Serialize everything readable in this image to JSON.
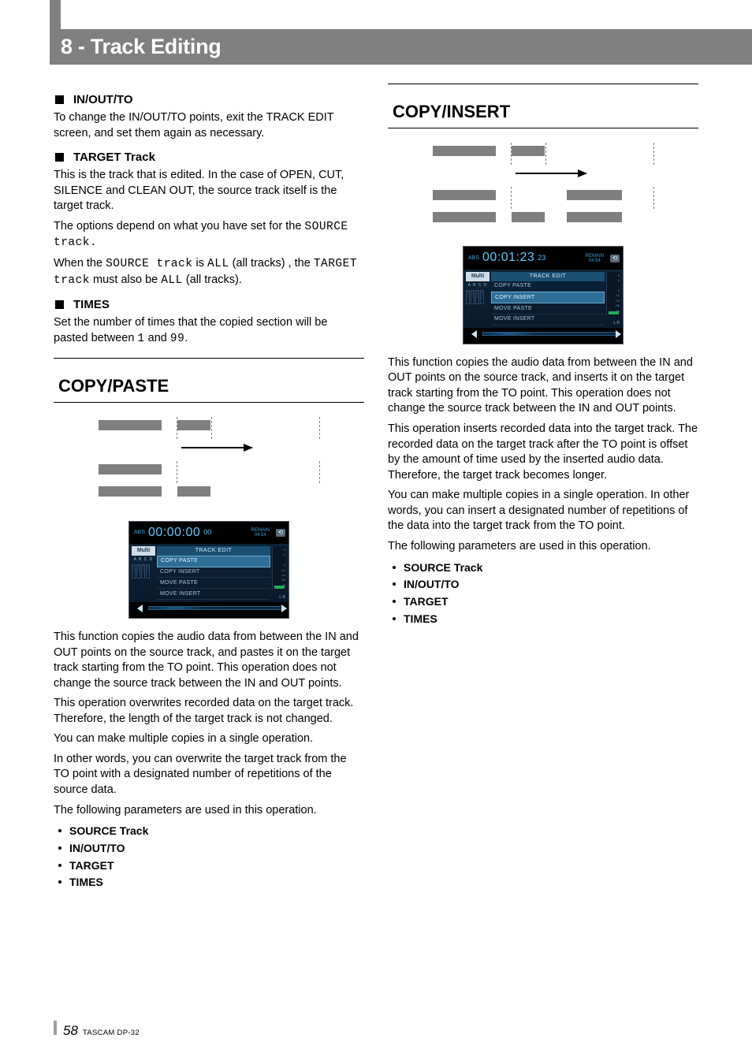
{
  "header": {
    "title": "8 - Track Editing"
  },
  "left": {
    "h_inout": "IN/OUT/TO",
    "p_inout": "To change the IN/OUT/TO points, exit the TRACK EDIT screen, and set them again as necessary.",
    "h_target": "TARGET Track",
    "p_target1": "This is the track that is edited. In the case of OPEN, CUT, SILENCE and CLEAN OUT, the source track itself is the target track.",
    "p_target2a": "The options depend on what you have set for the ",
    "p_target2b": "SOURCE track.",
    "p_target3a": "When the ",
    "p_target3b": "SOURCE track",
    "p_target3c": " is ",
    "p_target3d": "ALL",
    "p_target3e": " (all tracks) , the ",
    "p_target3f": "TARGET track",
    "p_target3g": " must also be ",
    "p_target3h": "ALL",
    "p_target3i": " (all tracks).",
    "h_times": "TIMES",
    "p_times1": "Set the number of times that the copied section will be pasted between ",
    "p_times2": "1",
    "p_times3": " and ",
    "p_times4": "99",
    "p_times5": ".",
    "section": "COPY/PASTE",
    "lcd": {
      "abs": "ABS",
      "time": "00:00:00",
      "sub": "00",
      "remain_lbl": "REMAIN",
      "remain_val": "04:54",
      "multi": "Multi",
      "abcd": "A B C D",
      "menu_title": "TRACK EDIT",
      "menu": [
        "COPY PASTE",
        "COPY INSERT",
        "MOVE PASTE",
        "MOVE INSERT"
      ]
    },
    "desc1": "This function copies the audio data from between the IN and OUT points on the source track, and pastes it on the target track starting from the TO point. This operation does not change the source track between the IN and OUT points.",
    "desc2": "This operation overwrites recorded data on the target track. Therefore, the length of the target track is not changed.",
    "desc3": "You can make multiple copies in a single operation.",
    "desc4": "In other words, you can overwrite the target track from the TO point with a designated number of repetitions of the source data.",
    "desc5": "The following parameters are used in this operation.",
    "params": [
      "SOURCE Track",
      "IN/OUT/TO",
      "TARGET",
      "TIMES"
    ]
  },
  "right": {
    "section": "COPY/INSERT",
    "lcd": {
      "abs": "ABS",
      "time": "00:01:23",
      "sub": "23",
      "remain_lbl": "REMAIN",
      "remain_val": "04:54",
      "multi": "Multi",
      "abcd": "A B C D",
      "menu_title": "TRACK EDIT",
      "menu": [
        "COPY PASTE",
        "COPY INSERT",
        "MOVE PASTE",
        "MOVE INSERT"
      ]
    },
    "desc1": "This function copies the audio data from between the IN and OUT points on the source track, and inserts it on the target track starting from the TO point. This operation does not change the source track between the IN and OUT points.",
    "desc2": "This operation inserts recorded data into the target track. The recorded data on the target track after the TO point is offset by the amount of time used by the inserted audio data. Therefore, the target track becomes longer.",
    "desc3": "You can make multiple copies in a single operation. In other words, you can insert a designated number of repetitions of the data into the target track from the TO point.",
    "desc4": "The following parameters are used in this operation.",
    "params": [
      "SOURCE Track",
      "IN/OUT/TO",
      "TARGET",
      "TIMES"
    ]
  },
  "footer": {
    "page": "58",
    "model": "TASCAM DP-32"
  }
}
